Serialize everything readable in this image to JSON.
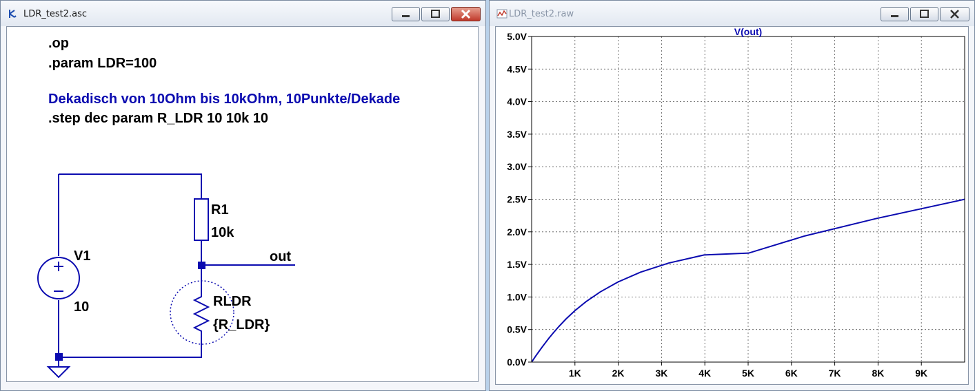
{
  "left_window": {
    "title": "LDR_test2.asc",
    "directives": [
      {
        "text": ".op",
        "color": "#000000"
      },
      {
        "text": ".param LDR=100",
        "color": "#000000"
      },
      {
        "text": "Dekadisch von 10Ohm bis 10kOhm, 10Punkte/Dekade",
        "color": "#0b0bb0"
      },
      {
        "text": ".step dec param R_LDR 10 10k 10",
        "color": "#000000"
      }
    ],
    "components": {
      "r1_name": "R1",
      "r1_value": "10k",
      "rldr_name": "RLDR",
      "rldr_value": "{R_LDR}",
      "v1_name": "V1",
      "v1_value": "10",
      "net_label": "out"
    },
    "colors": {
      "wire": "#0b0bb0",
      "junction": "#0b0bb0"
    }
  },
  "right_window": {
    "title": "LDR_test2.raw",
    "chart_data": {
      "type": "line",
      "title": "V(out)",
      "xlabel": "",
      "ylabel": "",
      "xlim": [
        0,
        10000
      ],
      "ylim": [
        0,
        5
      ],
      "x_ticks": [
        "1K",
        "2K",
        "3K",
        "4K",
        "5K",
        "6K",
        "7K",
        "8K",
        "9K"
      ],
      "y_ticks": [
        "0.0V",
        "0.5V",
        "1.0V",
        "1.5V",
        "2.0V",
        "2.5V",
        "3.0V",
        "3.5V",
        "4.0V",
        "4.5V",
        "5.0V"
      ],
      "grid": true,
      "series": [
        {
          "name": "V(out)",
          "color": "#0b0bb0",
          "x": [
            10,
            12.6,
            15.8,
            20,
            25.1,
            31.6,
            39.8,
            50.1,
            63.1,
            79.4,
            100,
            125.9,
            158.5,
            199.5,
            251.2,
            316.2,
            398.1,
            501.2,
            631,
            794.3,
            1000,
            1258.9,
            1584.9,
            1995.3,
            2511.9,
            3162.3,
            3981.1,
            5011.9,
            6309.6,
            7943.3,
            10000
          ],
          "values": [
            0.01,
            0.0126,
            0.0158,
            0.02,
            0.025,
            0.0315,
            0.0396,
            0.0497,
            0.0624,
            0.0782,
            0.098,
            0.1226,
            0.1532,
            0.1911,
            0.2379,
            0.2953,
            0.3654,
            0.4494,
            0.5481,
            0.6619,
            0.7905,
            0.9294,
            1.0777,
            1.2304,
            1.3801,
            1.5203,
            1.6449,
            1.6736,
            1.9373,
            2.2022,
            2.5
          ]
        }
      ]
    }
  }
}
